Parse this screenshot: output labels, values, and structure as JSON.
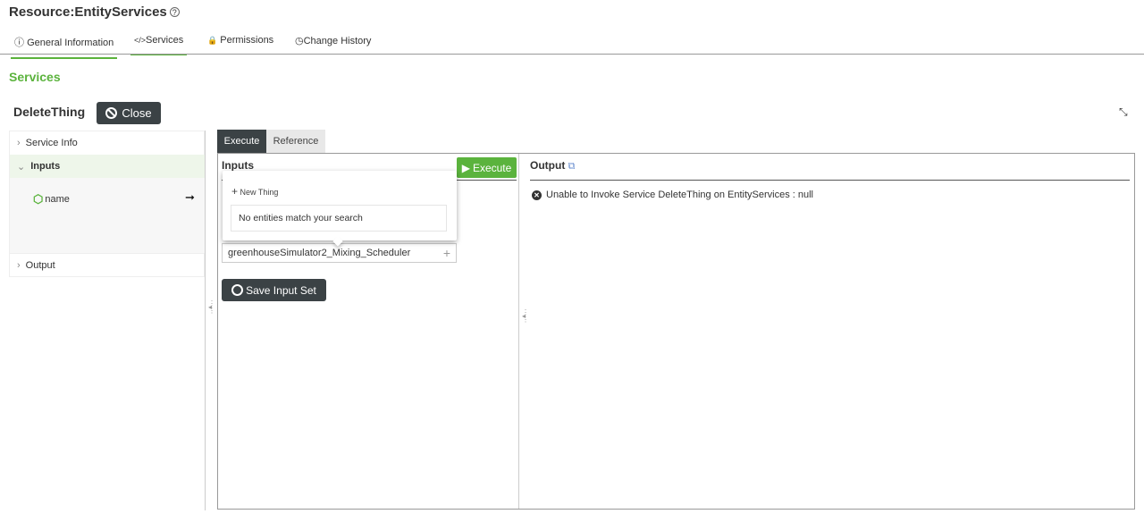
{
  "header": {
    "resource_label": "Resource:",
    "resource_name": "EntityServices",
    "help_icon": "?"
  },
  "tabs": [
    {
      "label": "General Information",
      "icon": "info-icon"
    },
    {
      "label": "Services",
      "icon": "code-icon"
    },
    {
      "label": "Permissions",
      "icon": "lock-icon"
    },
    {
      "label": "Change History",
      "icon": "clock-icon"
    }
  ],
  "section_title": "Services",
  "service": {
    "name": "DeleteThing",
    "close_label": "Close"
  },
  "left_panel": {
    "service_info": "Service Info",
    "inputs": "Inputs",
    "param": "name",
    "output": "Output"
  },
  "exec_tabs": {
    "execute": "Execute",
    "reference": "Reference"
  },
  "inputs": {
    "title": "Inputs",
    "execute_button": "Execute",
    "field_value": "greenhouseSimulator2_Mixing_Scheduler",
    "save_button": "Save Input Set"
  },
  "popup": {
    "new_thing": "New Thing",
    "no_match": "No entities match your search"
  },
  "output": {
    "title": "Output",
    "error": "Unable to Invoke Service DeleteThing on EntityServices : null"
  },
  "colors": {
    "accent": "#5bb33d",
    "dark": "#3b4245"
  }
}
